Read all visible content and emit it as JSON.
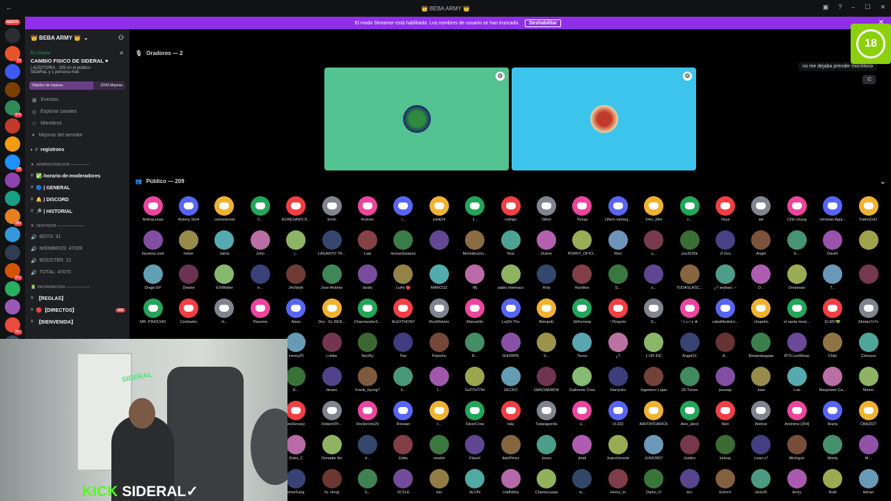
{
  "titlebar": {
    "title": "👑 BEBA ARMY 👑"
  },
  "banner": {
    "text": "El modo Streamer está habilitado. Los nombres de usuario se han truncado.",
    "button": "Deshabilitar"
  },
  "rail": {
    "nuevo": "NUEVO",
    "badges": [
      "52",
      "479",
      "48",
      "386",
      "812",
      "157"
    ],
    "colors": [
      "#2b2d31",
      "#e6552a",
      "#3d5af1",
      "#7b3f00",
      "#2e8b57",
      "#c0392b",
      "#f39c12",
      "#1e90ff",
      "#8e44ad",
      "#16a085",
      "#e67e22",
      "#3498db",
      "#2c3e50",
      "#d35400",
      "#27ae60",
      "#9b59b6",
      "#e74c3c",
      "#34495e",
      "#f1c40f",
      "#1abc9c"
    ]
  },
  "sidebar": {
    "server_name": "👑 BEBA ARMY 👑",
    "live": {
      "status": "En Directo",
      "title": "CAMBIO FISICO DE SIDERAL ♥",
      "line1": "| AUDITORIA · 209 en el público",
      "line2": "SiDeRaL y 1 persona más"
    },
    "goal": {
      "label": "Objetivo de mejoras",
      "value": "22/33 Mejoras",
      "progress": 0.67
    },
    "menu": [
      "Eventos",
      "Explorar canales",
      "Miembros",
      "Mejoras del servidor"
    ],
    "channels_top": [
      "registroes"
    ],
    "cat_admin": "ADMINISTRACION ───────",
    "admin_channels": [
      "✅-horario-de-moderadores",
      "🔵 | GENERAL",
      "🔔 | DISCORD",
      "🔎 | HISTORIAL"
    ],
    "cat_server": "SERVIDOR ──────────",
    "stats": [
      "BOTS: 31",
      "MIEMBROS: 47039",
      "BOOSTER: 21",
      "TOTAL: 47070"
    ],
    "cat_info": "INFORMACION ─────────",
    "info_channels": [
      "【REGLAS】",
      "🔴【DIRECTOS】",
      "【BIENVENIDA】"
    ],
    "info_pill": "112"
  },
  "main": {
    "speakers_label": "Oradores — 2",
    "public_label": "Público — 209",
    "chat_msg": "no me dejaba prender micrófono",
    "chat_msg2": ":C",
    "age_badge": "18",
    "tiles": [
      {
        "color": "#53c391"
      },
      {
        "color": "#3dc4ed"
      }
    ]
  },
  "audience": [
    [
      "Antivacunas",
      "Antony SinH",
      "carlosleonel",
      "C...",
      "EGRESADO D...",
      "Emin",
      "ferzizer",
      "l...",
      "joelk24",
      "J...",
      "rodrigo",
      "Silent",
      "Tomas",
      "Uñero extranj...",
      "X4vi_JAH",
      "x...",
      "Yisus",
      "ale",
      "Chin chung",
      "christian Agui...",
      "FabriiZziO"
    ],
    [
      "faceless void",
      "heber",
      "Jaime",
      "John",
      "j...",
      "LAGARTO TR...",
      "Laia",
      "leonardosaenz",
      "",
      "Michidescho...",
      "Noa",
      "Ouken",
      "PORKY_OFICI...",
      "Riez",
      "u...",
      "you2026k",
      "JI Ozu",
      "Angel",
      "b...",
      "Daveh",
      ""
    ],
    [
      "Drago EP",
      "Dwane",
      "EXIWalter",
      "e...",
      "JhoStyle",
      "Jose Antonio",
      "larafu",
      "LuAn 🔴",
      "MARCOZ",
      "Mj",
      "pablo telemaco",
      "Roly",
      "Runtitoo",
      "S...",
      "s...",
      "TODASLASC...",
      "¿? seybarc ♂",
      "D...",
      "Drepesao",
      "T...",
      ""
    ],
    [
      "MR. PINOCHO",
      "Centrador",
      "H...",
      "Flavsme",
      "Alass",
      "Dey - EL REN...",
      "Charmander3...",
      "ALEXTHONY",
      "ReyMisterio",
      "Manuelito",
      "LuiZhi Tho",
      "BetopuE",
      "SirKenway",
      "! Pinguim",
      "G...",
      "! L u i s ★",
      "caballitodetro...",
      "chupetin",
      "el santa mont...",
      "ELMO💚",
      "Eltetas7v7x"
    ],
    [
      "",
      "",
      "",
      "",
      "eremy20",
      "Lokliw",
      "NaUKy",
      "Pan",
      "Patosho",
      "R...",
      "SHOWPE",
      "S...",
      "Tavoo",
      "¿?",
      "1 OR iDC",
      "Angel1X",
      "A...",
      "Botamatugaaa",
      "BTS.LeoMessi",
      "Chiki",
      "Chinosor"
    ],
    [
      "",
      "",
      "",
      "",
      "E...",
      "faraon",
      "Frank_hyung7",
      "F...",
      "f...",
      "GaTiToTiTeI",
      "GECKO",
      "GMKOAEMOK",
      "Guilierme Crizz",
      "Harrycito",
      "Ingeniero Lujan",
      "JD Torres",
      "jesusqs",
      "Juan",
      "Luis",
      "Maxpower Ca...",
      "Memo"
    ],
    [
      "",
      "",
      "",
      "",
      "ewSensey",
      "Robert//Pr...",
      "Rockercito29",
      "Rvssian",
      "r...",
      "SilverCrow",
      "tala",
      "Tutialagordis",
      "s...",
      "VL322",
      "AIRITAYDARICK",
      "Alex_abcd",
      "Alzir",
      "Andree",
      "Anónimo [254]",
      "Arana",
      "CBA2027"
    ],
    [
      "",
      "",
      "",
      "",
      "Doko_C",
      "Donador fiel",
      "d...",
      "Eddu",
      "exiahh",
      "Flavio!",
      "ItaloPérez",
      "Jesuu",
      "jhoel",
      "Juancheracle",
      "JUNIOR07",
      "Justino",
      "kelsop",
      "Luiss x7",
      "Michigun",
      "Monty",
      "M..."
    ],
    [
      "",
      "",
      "",
      "",
      "olverFang",
      "Sr. Hong",
      "S...",
      "ZCSLE",
      "luis",
      "ALVIN",
      "crisffvbha",
      "Chamacuaaa",
      "w...",
      "Henry_to",
      "Darko_O",
      "dcc",
      "Entrrrrr",
      "elvis26",
      "Army",
      "Rutti",
      "Adrian"
    ]
  ],
  "webcam": {
    "logo": "SIDERAL"
  },
  "overlay": {
    "kick": "KICK",
    "name": "SIDERAL✓"
  }
}
